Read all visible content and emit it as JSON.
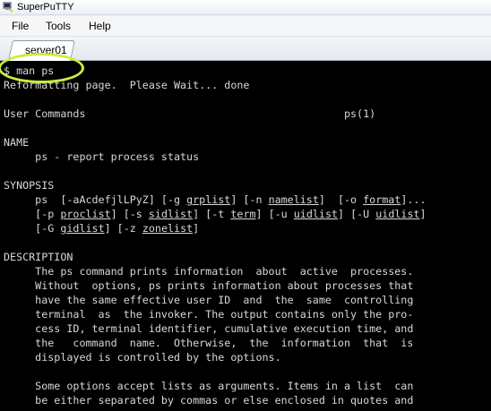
{
  "window": {
    "title": "SuperPuTTY"
  },
  "menu": {
    "items": [
      "File",
      "Tools",
      "Help"
    ]
  },
  "tabs": [
    {
      "label": "server01"
    }
  ],
  "terminal": {
    "lines": [
      [
        {
          "t": "$ man ps"
        }
      ],
      [
        {
          "t": "Reformatting page.  Please Wait... done"
        }
      ],
      [
        {
          "t": ""
        }
      ],
      [
        {
          "t": "User Commands                                         ps(1)"
        }
      ],
      [
        {
          "t": ""
        }
      ],
      [
        {
          "t": "NAME"
        }
      ],
      [
        {
          "t": "     ps - report process status"
        }
      ],
      [
        {
          "t": ""
        }
      ],
      [
        {
          "t": "SYNOPSIS"
        }
      ],
      [
        {
          "t": "     ps  [-aAcdefjlLPyZ] [-g "
        },
        {
          "t": "grplist",
          "u": true
        },
        {
          "t": "] [-n "
        },
        {
          "t": "namelist",
          "u": true
        },
        {
          "t": "]  [-o "
        },
        {
          "t": "format",
          "u": true
        },
        {
          "t": "]..."
        }
      ],
      [
        {
          "t": "     [-p "
        },
        {
          "t": "proclist",
          "u": true
        },
        {
          "t": "] [-s "
        },
        {
          "t": "sidlist",
          "u": true
        },
        {
          "t": "] [-t "
        },
        {
          "t": "term",
          "u": true
        },
        {
          "t": "] [-u "
        },
        {
          "t": "uidlist",
          "u": true
        },
        {
          "t": "] [-U "
        },
        {
          "t": "uidlist",
          "u": true
        },
        {
          "t": "]"
        }
      ],
      [
        {
          "t": "     [-G "
        },
        {
          "t": "gidlist",
          "u": true
        },
        {
          "t": "] [-z "
        },
        {
          "t": "zonelist",
          "u": true
        },
        {
          "t": "]"
        }
      ],
      [
        {
          "t": ""
        }
      ],
      [
        {
          "t": "DESCRIPTION"
        }
      ],
      [
        {
          "t": "     The ps command prints information  about  active  processes."
        }
      ],
      [
        {
          "t": "     Without  options, ps prints information about processes that"
        }
      ],
      [
        {
          "t": "     have the same effective user ID  and  the  same  controlling"
        }
      ],
      [
        {
          "t": "     terminal  as  the invoker. The output contains only the pro-"
        }
      ],
      [
        {
          "t": "     cess ID, terminal identifier, cumulative execution time, and"
        }
      ],
      [
        {
          "t": "     the   command  name.  Otherwise,  the  information  that  is"
        }
      ],
      [
        {
          "t": "     displayed is controlled by the options."
        }
      ],
      [
        {
          "t": ""
        }
      ],
      [
        {
          "t": "     Some options accept lists as arguments. Items in a list  can"
        }
      ],
      [
        {
          "t": "     be either separated by commas or else enclosed in quotes and"
        }
      ]
    ]
  },
  "annotation": {
    "color": "#c8f03c"
  },
  "colors": {
    "terminal_bg": "#000000",
    "terminal_fg": "#d8d8d8"
  }
}
